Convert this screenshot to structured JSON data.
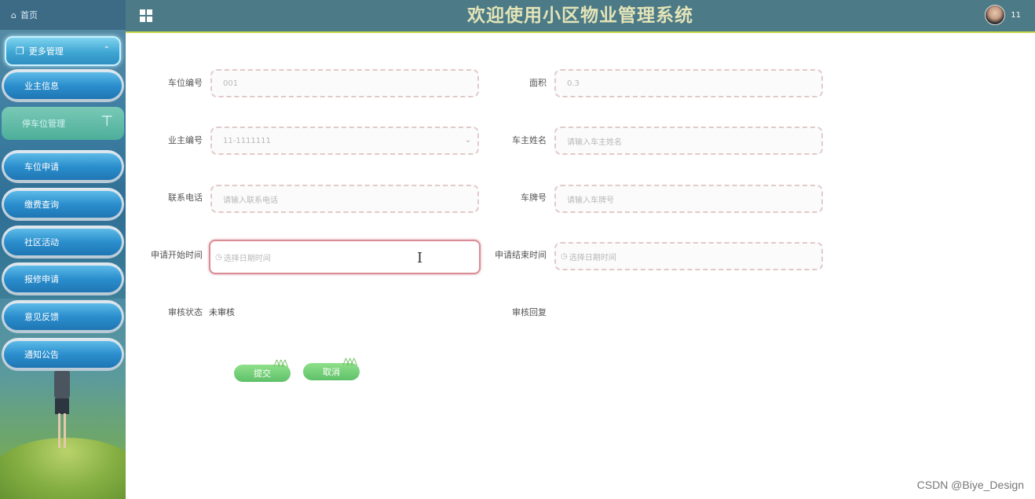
{
  "colors": {
    "header_bg": "#4c7a86",
    "title": "#e3e4b8",
    "menu_blue": "#2b8ecd",
    "menu_active": "#4fb39a",
    "button_green": "#6fc973",
    "focus_border": "#d98d97"
  },
  "sidebar": {
    "home": {
      "icon": "home-icon",
      "label": "首页"
    },
    "group": {
      "icon": "copy-icon",
      "label": "更多管理",
      "expanded_icon": "chevron-up-icon"
    },
    "items": [
      {
        "label": "业主信息"
      },
      {
        "label": "停车位管理",
        "active": true,
        "icon": "pin-icon"
      },
      {
        "label": "车位申请"
      },
      {
        "label": "缴费查询"
      },
      {
        "label": "社区活动"
      },
      {
        "label": "报修申请"
      },
      {
        "label": "意见反馈"
      },
      {
        "label": "通知公告"
      }
    ]
  },
  "header": {
    "title": "欢迎使用小区物业管理系统",
    "user": "11",
    "menu_icon": "grid-icon"
  },
  "form": {
    "parking_no": {
      "label": "车位编号",
      "value": "001"
    },
    "area": {
      "label": "面积",
      "value": "0.3"
    },
    "owner_no": {
      "label": "业主编号",
      "value": "11-1111111"
    },
    "owner_name": {
      "label": "车主姓名",
      "placeholder": "请输入车主姓名"
    },
    "phone": {
      "label": "联系电话",
      "placeholder": "请输入联系电话"
    },
    "plate": {
      "label": "车牌号",
      "placeholder": "请输入车牌号"
    },
    "start_time": {
      "label": "申请开始时间",
      "placeholder": "选择日期时间"
    },
    "end_time": {
      "label": "申请结束时间",
      "placeholder": "选择日期时间"
    },
    "review_status": {
      "label": "审核状态",
      "value": "未审核"
    },
    "review_reply": {
      "label": "审核回复",
      "value": ""
    },
    "submit_label": "提交",
    "cancel_label": "取消"
  },
  "watermark": "CSDN @Biye_Design"
}
